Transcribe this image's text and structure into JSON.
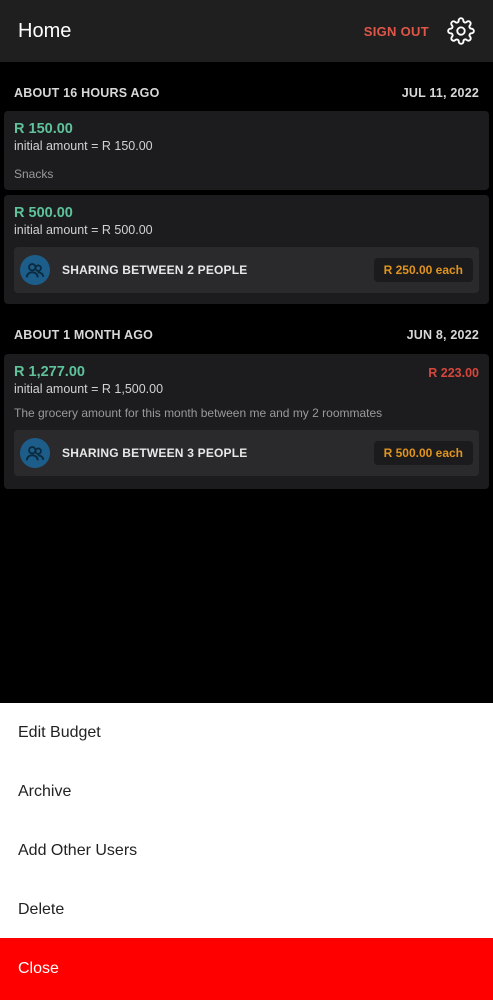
{
  "appbar": {
    "title": "Home",
    "sign_out": "SIGN OUT",
    "settings_icon": "gear-icon"
  },
  "groups": [
    {
      "relative": "ABOUT 16 HOURS AGO",
      "date": "JUL 11, 2022",
      "budgets": [
        {
          "amount": "R 150.00",
          "initial": "initial amount = R 150.00",
          "description": "Snacks"
        },
        {
          "amount": "R 500.00",
          "initial": "initial amount = R 500.00",
          "share_label": "SHARING BETWEEN 2 PEOPLE",
          "share_each": "R 250.00 each"
        }
      ]
    },
    {
      "relative": "ABOUT 1 MONTH AGO",
      "date": "JUN 8, 2022",
      "budgets": [
        {
          "amount": "R 1,277.00",
          "difference": "R 223.00",
          "initial": "initial amount = R 1,500.00",
          "description": "The grocery amount for this month between me and my 2 roommates",
          "share_label": "SHARING BETWEEN 3 PEOPLE",
          "share_each": "R 500.00 each"
        }
      ]
    }
  ],
  "sheet": {
    "items": [
      "Edit Budget",
      "Archive",
      "Add Other Users",
      "Delete"
    ],
    "close": "Close"
  },
  "colors": {
    "amount": "#5fc29a",
    "difference": "#d5463c",
    "share_each": "#e0941f",
    "sign_out": "#e0574a",
    "close_bg": "#ff0000"
  }
}
